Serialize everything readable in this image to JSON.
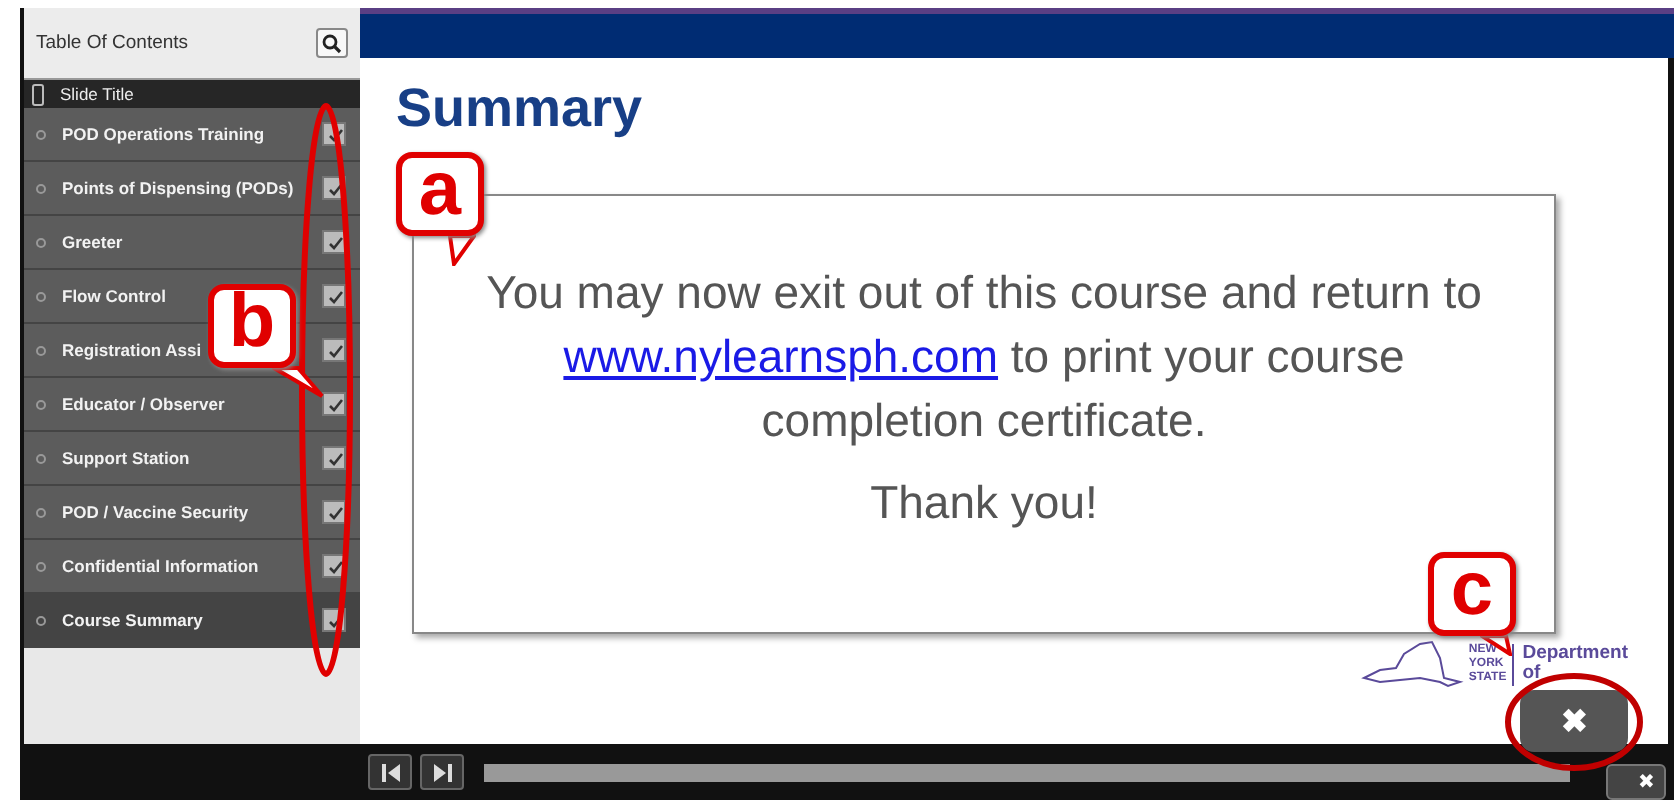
{
  "sidebar": {
    "title": "Table Of Contents",
    "header_row": "Slide Title",
    "items": [
      {
        "label": "POD Operations Training",
        "checked": true,
        "selected": false
      },
      {
        "label": "Points of Dispensing (PODs)",
        "checked": true,
        "selected": false
      },
      {
        "label": "Greeter",
        "checked": true,
        "selected": false
      },
      {
        "label": "Flow Control",
        "checked": true,
        "selected": false
      },
      {
        "label": "Registration Assi",
        "checked": true,
        "selected": false
      },
      {
        "label": "Educator / Observer",
        "checked": true,
        "selected": false
      },
      {
        "label": "Support Station",
        "checked": true,
        "selected": false
      },
      {
        "label": "POD / Vaccine Security",
        "checked": true,
        "selected": false
      },
      {
        "label": "Confidential Information",
        "checked": true,
        "selected": false
      },
      {
        "label": "Course Summary",
        "checked": true,
        "selected": true
      }
    ]
  },
  "slide": {
    "title": "Summary",
    "message_before": "You may now exit out of this course and return to",
    "link": "www.nylearnsph.com",
    "message_after": "to print your course completion certificate.",
    "thanks": "Thank you!",
    "logo_lines": [
      "NEW",
      "YORK",
      "STATE"
    ],
    "department": [
      "Department",
      "of"
    ],
    "close_label": "✖"
  },
  "player": {
    "close_label": "✖"
  },
  "callouts": [
    {
      "letter": "a"
    },
    {
      "letter": "b"
    },
    {
      "letter": "c"
    }
  ]
}
